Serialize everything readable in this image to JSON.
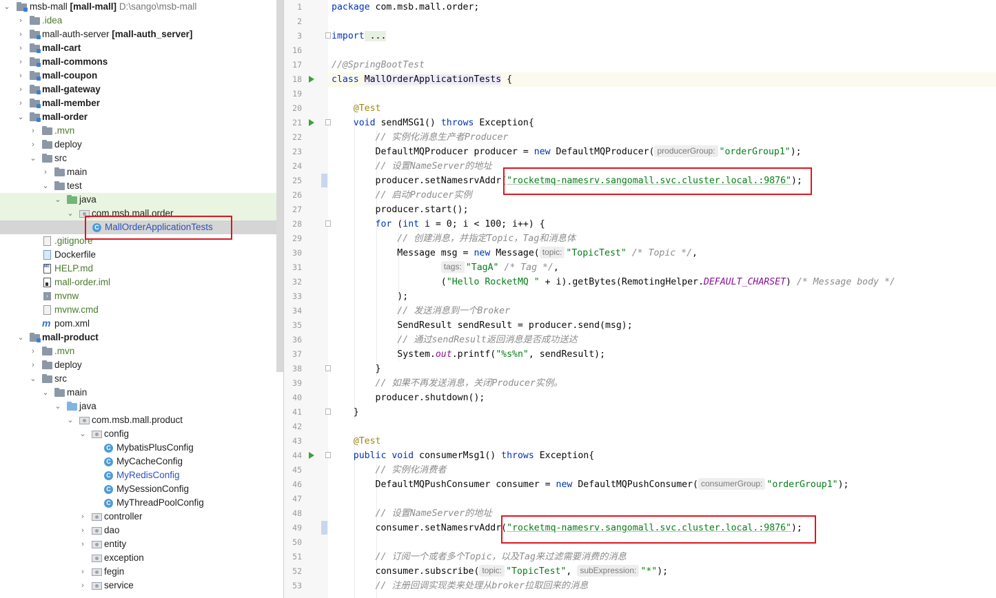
{
  "project_tree": {
    "root": {
      "name": "msb-mall",
      "module": "[mall-mall]",
      "path": "D:\\sango\\msb-mall"
    },
    "items": [
      {
        "label": ".idea"
      },
      {
        "label": "mall-auth-server",
        "module": "[mall-auth_server]"
      },
      {
        "label": "mall-cart"
      },
      {
        "label": "mall-commons"
      },
      {
        "label": "mall-coupon"
      },
      {
        "label": "mall-gateway"
      },
      {
        "label": "mall-member"
      },
      {
        "label": "mall-order"
      },
      {
        "label": ".mvn"
      },
      {
        "label": "deploy"
      },
      {
        "label": "src"
      },
      {
        "label": "main"
      },
      {
        "label": "test"
      },
      {
        "label": "java"
      },
      {
        "label": "com.msb.mall.order"
      },
      {
        "label": "MallOrderApplicationTests"
      },
      {
        "label": ".gitignore"
      },
      {
        "label": "Dockerfile"
      },
      {
        "label": "HELP.md"
      },
      {
        "label": "mall-order.iml"
      },
      {
        "label": "mvnw"
      },
      {
        "label": "mvnw.cmd"
      },
      {
        "label": "pom.xml"
      },
      {
        "label": "mall-product"
      },
      {
        "label": ".mvn"
      },
      {
        "label": "deploy"
      },
      {
        "label": "src"
      },
      {
        "label": "main"
      },
      {
        "label": "java"
      },
      {
        "label": "com.msb.mall.product"
      },
      {
        "label": "config"
      },
      {
        "label": "MybatisPlusConfig"
      },
      {
        "label": "MyCacheConfig"
      },
      {
        "label": "MyRedisConfig"
      },
      {
        "label": "MySessionConfig"
      },
      {
        "label": "MyThreadPoolConfig"
      },
      {
        "label": "controller"
      },
      {
        "label": "dao"
      },
      {
        "label": "entity"
      },
      {
        "label": "exception"
      },
      {
        "label": "fegin"
      },
      {
        "label": "service"
      }
    ]
  },
  "editor": {
    "line_numbers": [
      "1",
      "2",
      "3",
      "16",
      "17",
      "18",
      "19",
      "20",
      "21",
      "22",
      "23",
      "24",
      "25",
      "26",
      "27",
      "28",
      "29",
      "30",
      "31",
      "32",
      "33",
      "34",
      "35",
      "36",
      "37",
      "38",
      "39",
      "40",
      "41",
      "42",
      "43",
      "44",
      "45",
      "46",
      "47",
      "48",
      "49",
      "50",
      "51",
      "52",
      "53"
    ],
    "code": {
      "l1_kw": "package",
      "l1_rest": " com.msb.mall.order;",
      "l3_kw": "import",
      "l3_rest": " ...",
      "l17": "//@SpringBootTest",
      "l18_kw": "class",
      "l18_name": "MallOrderApplicationTests",
      "l18_rest": " {",
      "l20": "@Test",
      "l21_kw1": "void",
      "l21_name": " sendMSG1() ",
      "l21_kw2": "throws",
      "l21_rest": " Exception{",
      "l22": "// 实例化消息生产者Producer",
      "l23_a": "DefaultMQProducer producer = ",
      "l23_kw": "new",
      "l23_b": " DefaultMQProducer(",
      "l23_hint": "producerGroup:",
      "l23_str": "\"orderGroup1\"",
      "l23_c": ");",
      "l24": "// 设置NameServer的地址",
      "l25_a": "producer.setNamesrvAddr(",
      "l25_str": "\"rocketmq-namesrv.sangomall.svc.cluster.local.:9876\"",
      "l25_b": ");",
      "l26": "// 启动Producer实例",
      "l27": "producer.start();",
      "l28_kw1": "for",
      "l28_a": " (",
      "l28_kw2": "int",
      "l28_b": " i = 0; i < 100; i++) {",
      "l29": "// 创建消息，并指定Topic，Tag和消息体",
      "l30_a": "Message msg = ",
      "l30_kw": "new",
      "l30_b": " Message(",
      "l30_hint": "topic:",
      "l30_str": "\"TopicTest\"",
      "l30_cmt": " /* Topic */",
      "l30_c": ",",
      "l31_hint": "tags:",
      "l31_str": "\"TagA\"",
      "l31_cmt": " /* Tag */",
      "l31_c": ",",
      "l32_a": "(",
      "l32_str": "\"Hello RocketMQ \"",
      "l32_b": " + i).getBytes(RemotingHelper.",
      "l32_fld": "DEFAULT_CHARSET",
      "l32_c": ") ",
      "l32_cmt": "/* Message body */",
      "l33": ");",
      "l34": "// 发送消息到一个Broker",
      "l35": "SendResult sendResult = producer.send(msg);",
      "l36": "// 通过sendResult返回消息是否成功送达",
      "l37_a": "System.",
      "l37_fld": "out",
      "l37_b": ".printf(",
      "l37_str": "\"%s%n\"",
      "l37_c": ", sendResult);",
      "l38": "}",
      "l39": "// 如果不再发送消息，关闭Producer实例。",
      "l40": "producer.shutdown();",
      "l41": "}",
      "l43": "@Test",
      "l44_kw1": "public",
      "l44_kw2": " void",
      "l44_name": " consumerMsg1() ",
      "l44_kw3": "throws",
      "l44_rest": " Exception{",
      "l45": "// 实例化消费者",
      "l46_a": "DefaultMQPushConsumer consumer = ",
      "l46_kw": "new",
      "l46_b": " DefaultMQPushConsumer(",
      "l46_hint": "consumerGroup:",
      "l46_str": "\"orderGroup1\"",
      "l46_c": ");",
      "l48": "// 设置NameServer的地址",
      "l49_a": "consumer.setNamesrvAddr(",
      "l49_str": "\"rocketmq-namesrv.sangomall.svc.cluster.local.:9876\"",
      "l49_b": ");",
      "l51": "// 订阅一个或者多个Topic，以及Tag来过滤需要消费的消息",
      "l52_a": "consumer.subscribe(",
      "l52_hint1": "topic:",
      "l52_str1": "\"TopicTest\"",
      "l52_b": ", ",
      "l52_hint2": "subExpression:",
      "l52_str2": "\"*\"",
      "l52_c": ");",
      "l53": "// 注册回调实现类来处理从broker拉取回来的消息"
    }
  },
  "colors": {
    "keyword": "#0033b3",
    "string": "#067d17",
    "comment": "#8c8c8c",
    "annotation": "#9e880d",
    "highlight_box": "#e0141e"
  }
}
